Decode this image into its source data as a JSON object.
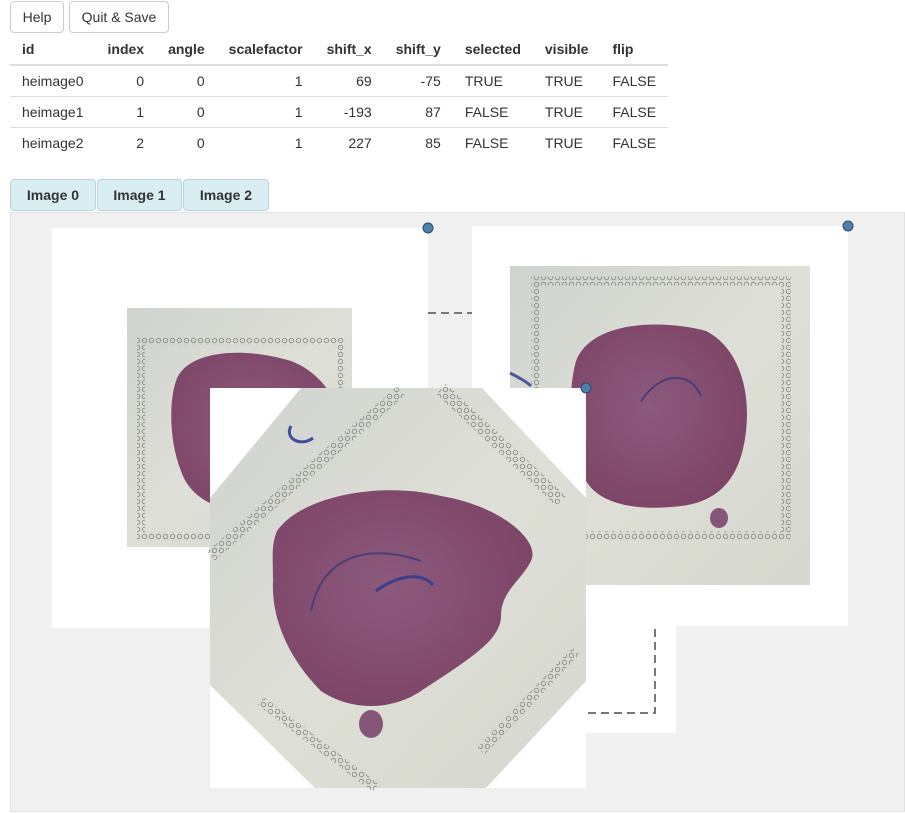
{
  "toolbar": {
    "help_label": "Help",
    "quit_label": "Quit & Save"
  },
  "table": {
    "columns": [
      "id",
      "index",
      "angle",
      "scalefactor",
      "shift_x",
      "shift_y",
      "selected",
      "visible",
      "flip"
    ],
    "rows": [
      {
        "id": "heimage0",
        "index": "0",
        "angle": "0",
        "scalefactor": "1",
        "shift_x": "69",
        "shift_y": "-75",
        "selected": "TRUE",
        "visible": "TRUE",
        "flip": "FALSE"
      },
      {
        "id": "heimage1",
        "index": "1",
        "angle": "0",
        "scalefactor": "1",
        "shift_x": "-193",
        "shift_y": "87",
        "selected": "FALSE",
        "visible": "TRUE",
        "flip": "FALSE"
      },
      {
        "id": "heimage2",
        "index": "2",
        "angle": "0",
        "scalefactor": "1",
        "shift_x": "227",
        "shift_y": "85",
        "selected": "FALSE",
        "visible": "TRUE",
        "flip": "FALSE"
      }
    ]
  },
  "tabs": [
    "Image 0",
    "Image 1",
    "Image 2"
  ],
  "colors": {
    "tissue": "#8a5577",
    "slide": "#dcddd3",
    "handle": "#4f7fa8",
    "tab_bg": "#d9eef3"
  }
}
